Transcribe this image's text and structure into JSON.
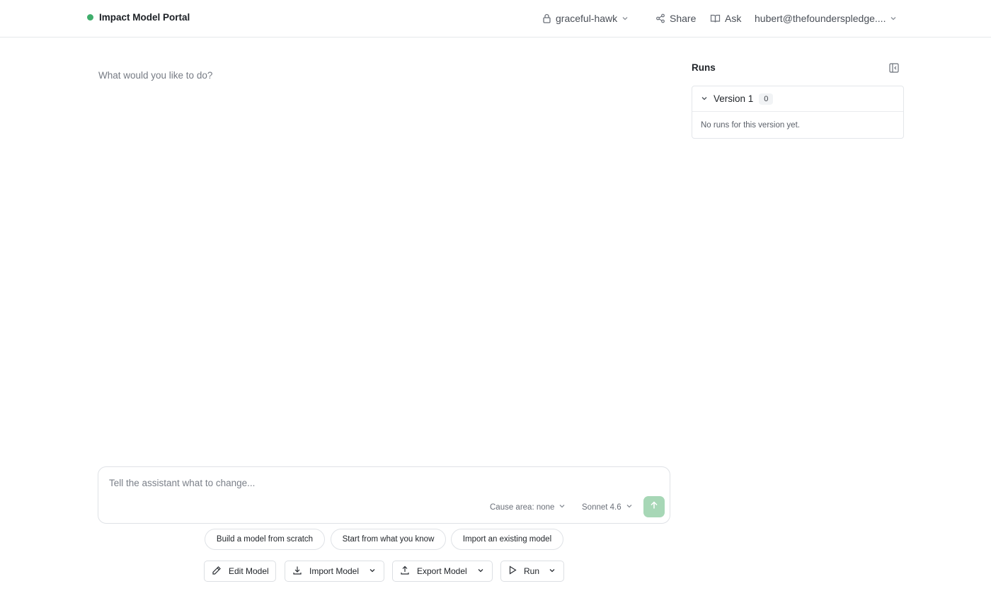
{
  "app": {
    "title": "Impact Model Portal",
    "status_color": "#3fae6c"
  },
  "header": {
    "project": {
      "name": "graceful-hawk",
      "icon": "lock-icon"
    },
    "share_label": "Share",
    "ask_label": "Ask",
    "user_email": "hubert@thefounderspledge...."
  },
  "main": {
    "heading": "What would you like to do?"
  },
  "runs": {
    "title": "Runs",
    "versions": [
      {
        "label": "Version 1",
        "count": "0",
        "empty_text": "No runs for this version yet."
      }
    ]
  },
  "composer": {
    "placeholder": "Tell the assistant what to change...",
    "cause_area": "Cause area: none",
    "model": "Sonnet 4.6",
    "send_color": "#a7d7b6"
  },
  "suggestions": [
    "Build a model from scratch",
    "Start from what you know",
    "Import an existing model"
  ],
  "actions": {
    "edit": "Edit Model",
    "import": "Import Model",
    "export": "Export Model",
    "run": "Run"
  }
}
